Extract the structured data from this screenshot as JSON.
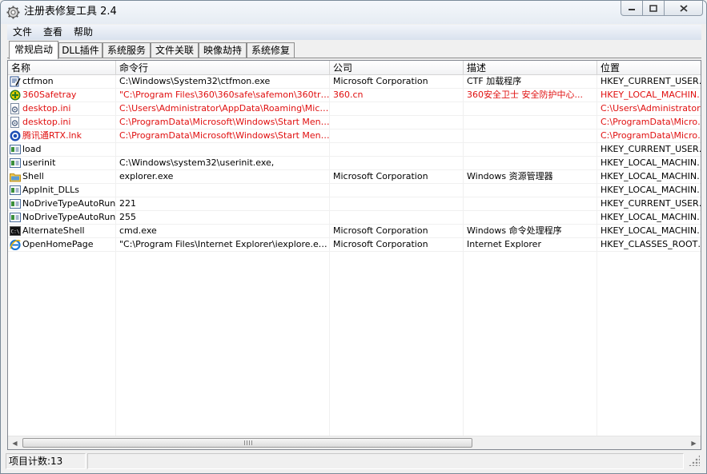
{
  "window": {
    "title": "注册表修复工具 2.4"
  },
  "menu": [
    "文件",
    "查看",
    "帮助"
  ],
  "tabs": [
    "常规启动",
    "DLL插件",
    "系统服务",
    "文件关联",
    "映像劫持",
    "系统修复"
  ],
  "active_tab": 0,
  "columns": [
    "名称",
    "命令行",
    "公司",
    "描述",
    "位置"
  ],
  "rows": [
    {
      "icon": "ctfmon-icon",
      "red": false,
      "cells": [
        "ctfmon",
        "C:\\Windows\\System32\\ctfmon.exe",
        "Microsoft Corporation",
        "CTF 加载程序",
        "HKEY_CURRENT_USER\\So"
      ]
    },
    {
      "icon": "safe360-icon",
      "red": true,
      "cells": [
        "360Safetray",
        "\"C:\\Program Files\\360\\360safe\\safemon\\360tray....",
        "360.cn",
        "360安全卫士 安全防护中心...",
        "HKEY_LOCAL_MACHINE\\S"
      ]
    },
    {
      "icon": "settings-file-icon",
      "red": true,
      "cells": [
        "desktop.ini",
        "C:\\Users\\Administrator\\AppData\\Roaming\\Microso...",
        "",
        "",
        "C:\\Users\\Administrator\\Ap"
      ]
    },
    {
      "icon": "settings-file-icon",
      "red": true,
      "cells": [
        "desktop.ini",
        "C:\\ProgramData\\Microsoft\\Windows\\Start Menu\\P...",
        "",
        "",
        "C:\\ProgramData\\Microsof"
      ]
    },
    {
      "icon": "rtx-icon",
      "red": true,
      "cells": [
        "腾讯通RTX.lnk",
        "C:\\ProgramData\\Microsoft\\Windows\\Start Menu\\P...",
        "",
        "",
        "C:\\ProgramData\\Microsof"
      ]
    },
    {
      "icon": "registry-value-icon",
      "red": false,
      "cells": [
        "load",
        "",
        "",
        "",
        "HKEY_CURRENT_USER\\So"
      ]
    },
    {
      "icon": "registry-value-icon",
      "red": false,
      "cells": [
        "userinit",
        "C:\\Windows\\system32\\userinit.exe,",
        "",
        "",
        "HKEY_LOCAL_MACHINE\\S"
      ]
    },
    {
      "icon": "explorer-folder-icon",
      "red": false,
      "cells": [
        "Shell",
        "explorer.exe",
        "Microsoft Corporation",
        "Windows 资源管理器",
        "HKEY_LOCAL_MACHINE\\S"
      ]
    },
    {
      "icon": "registry-value-icon",
      "red": false,
      "cells": [
        "AppInit_DLLs",
        "",
        "",
        "",
        "HKEY_LOCAL_MACHINE\\S"
      ]
    },
    {
      "icon": "registry-value-icon",
      "red": false,
      "cells": [
        "NoDriveTypeAutoRun",
        "221",
        "",
        "",
        "HKEY_CURRENT_USER\\So"
      ]
    },
    {
      "icon": "registry-value-icon",
      "red": false,
      "cells": [
        "NoDriveTypeAutoRun",
        "255",
        "",
        "",
        "HKEY_LOCAL_MACHINE\\S"
      ]
    },
    {
      "icon": "cmd-icon",
      "red": false,
      "cells": [
        "AlternateShell",
        "cmd.exe",
        "Microsoft Corporation",
        "Windows 命令处理程序",
        "HKEY_LOCAL_MACHINE\\S"
      ]
    },
    {
      "icon": "ie-icon",
      "red": false,
      "cells": [
        "OpenHomePage",
        "\"C:\\Program Files\\Internet Explorer\\iexplore.exe\"",
        "Microsoft Corporation",
        "Internet Explorer",
        "HKEY_CLASSES_ROOT\\CL"
      ]
    }
  ],
  "status": {
    "count_text": "项目计数:13",
    "pane2": ""
  },
  "colors": {
    "red_entry": "#e01010",
    "border": "#828790"
  }
}
